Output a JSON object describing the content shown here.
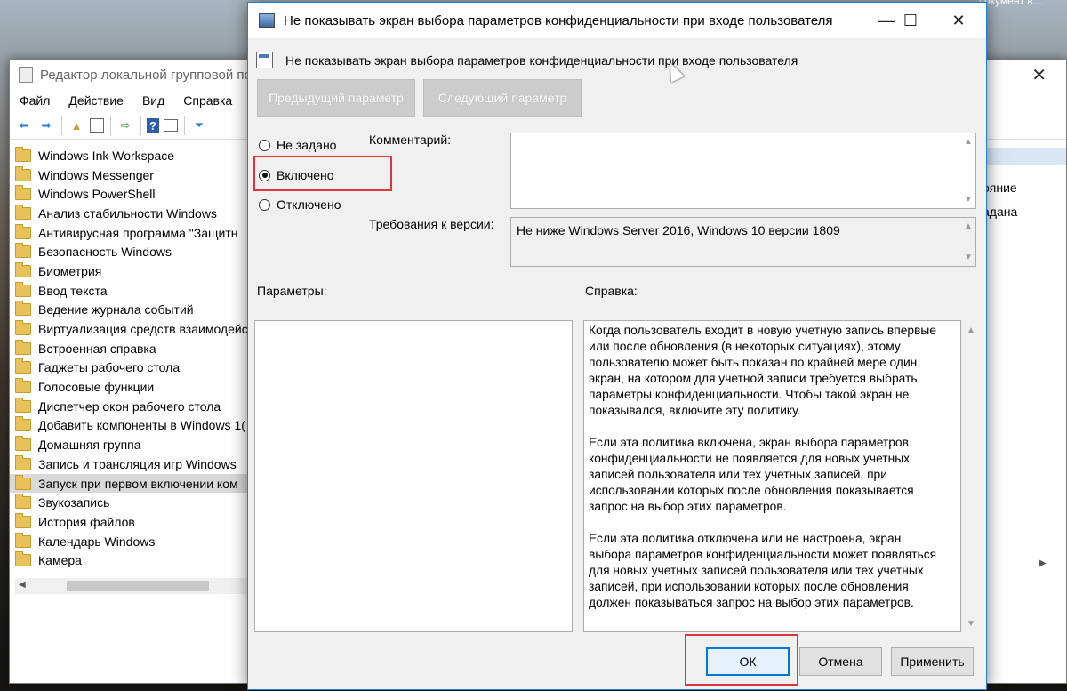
{
  "background": {
    "top_text": "документ в..."
  },
  "editor": {
    "title": "Редактор локальной групповой пол",
    "menu": [
      "Файл",
      "Действие",
      "Вид",
      "Справка"
    ],
    "tree": [
      "Windows Ink Workspace",
      "Windows Messenger",
      "Windows PowerShell",
      "Анализ стабильности Windows",
      "Антивирусная программа \"Защитн",
      "Безопасность Windows",
      "Биометрия",
      "Ввод текста",
      "Ведение журнала событий",
      "Виртуализация средств взаимодейс",
      "Встроенная справка",
      "Гаджеты рабочего стола",
      "Голосовые функции",
      "Диспетчер окон рабочего стола",
      "Добавить компоненты в Windows 1(",
      "Домашняя группа",
      "Запись и трансляция игр Windows",
      "Запуск при первом включении ком",
      "Звукозапись",
      "История файлов",
      "Календарь Windows",
      "Камера"
    ],
    "selected_index": 17,
    "right_column": [
      "ояние",
      "адана"
    ]
  },
  "dialog": {
    "title": "Не показывать экран выбора параметров конфиденциальности при входе пользователя",
    "header": "Не показывать экран выбора параметров конфиденциальности при входе пользователя",
    "prev_button": "Предыдущий параметр",
    "next_button": "Следующий параметр",
    "radios": [
      {
        "label": "Не задано",
        "checked": false
      },
      {
        "label": "Включено",
        "checked": true
      },
      {
        "label": "Отключено",
        "checked": false
      }
    ],
    "comment_label": "Комментарий:",
    "comment_value": "",
    "version_label": "Требования к версии:",
    "version_value": "Не ниже Windows Server 2016, Windows 10 версии 1809",
    "params_label": "Параметры:",
    "help_label": "Справка:",
    "help_paragraphs": [
      "Когда пользователь входит в новую учетную запись впервые или после обновления (в некоторых ситуациях), этому пользователю может быть показан по крайней мере один экран, на котором для учетной записи требуется выбрать параметры конфиденциальности. Чтобы такой экран не показывался, включите эту политику.",
      "Если эта политика включена, экран выбора параметров конфиденциальности не появляется для новых учетных записей пользователя или тех учетных записей, при использовании которых после обновления показывается запрос на выбор этих параметров.",
      "Если эта политика отключена или не настроена, экран выбора параметров конфиденциальности может появляться для новых учетных записей пользователя или тех учетных записей, при использовании которых после обновления должен показываться запрос на выбор этих параметров."
    ],
    "ok_button": "ОК",
    "cancel_button": "Отмена",
    "apply_button": "Применить"
  },
  "colors": {
    "highlight_border": "#e0363b",
    "default_button_border": "#0078d7",
    "selected_tree_row": "#d9d9d9"
  }
}
